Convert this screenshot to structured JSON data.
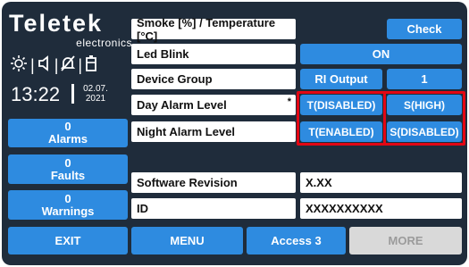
{
  "brand": {
    "name": "Teletek",
    "sub": "electronics"
  },
  "status_icons": [
    "sun-icon",
    "speaker-icon",
    "bell-off-icon",
    "battery-icon"
  ],
  "clock": {
    "time": "13:22",
    "date_line1": "02.07.",
    "date_line2": "2021"
  },
  "sidebar": {
    "alarms": {
      "count": "0",
      "label": "Alarms"
    },
    "faults": {
      "count": "0",
      "label": "Faults"
    },
    "warnings": {
      "count": "0",
      "label": "Warnings"
    }
  },
  "table": {
    "smoke_temp_label": "Smoke [%] / Temperature [°C]",
    "check_label": "Check",
    "led_blink_label": "Led Blink",
    "led_blink_value": "ON",
    "device_group_label": "Device Group",
    "ri_output_label": "RI Output",
    "ri_output_value": "1",
    "day_alarm_label": "Day Alarm Level",
    "day_alarm_marker": "*",
    "day_alarm_value1": "T(DISABLED)",
    "day_alarm_value2": "S(HIGH)",
    "night_alarm_label": "Night Alarm Level",
    "night_alarm_value1": "T(ENABLED)",
    "night_alarm_value2": "S(DISABLED)",
    "software_revision_label": "Software Revision",
    "software_revision_value": "X.XX",
    "id_label": "ID",
    "id_value": "XXXXXXXXXX"
  },
  "bottom_bar": {
    "exit": "EXIT",
    "menu": "MENU",
    "access": "Access 3",
    "more": "MORE"
  },
  "colors": {
    "panel_bg": "#1f2c3b",
    "button_blue": "#2e8be0",
    "highlight_red": "#e30613",
    "disabled_gray": "#d9d9d9"
  }
}
